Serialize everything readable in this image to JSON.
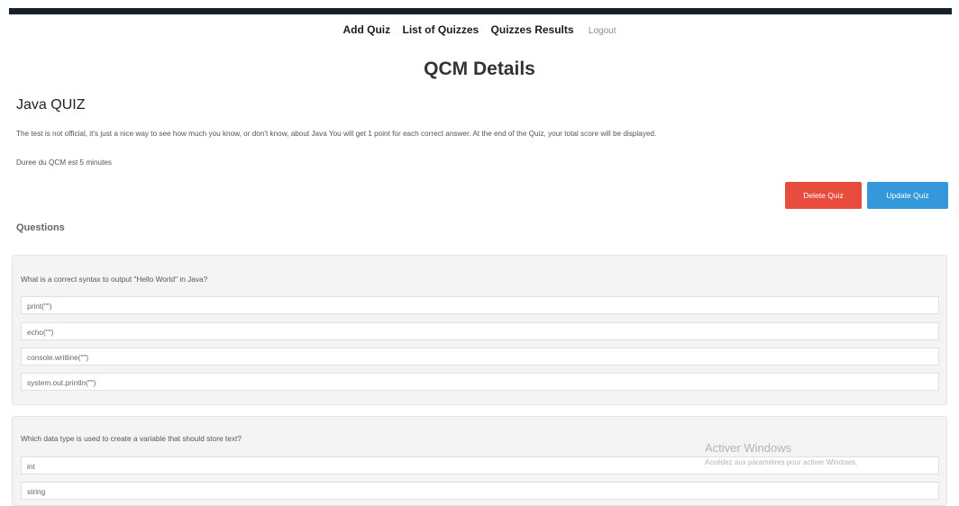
{
  "nav": {
    "add_quiz": "Add Quiz",
    "list_quizzes": "List of Quizzes",
    "quizzes_results": "Quizzes Results",
    "logout": "Logout"
  },
  "page_title": "QCM Details",
  "quiz": {
    "name": "Java QUIZ",
    "description": "The test is not official, it's just a nice way to see how much you know, or don't know, about Java You will get 1 point for each correct answer. At the end of the Quiz, your total score will be displayed.",
    "duration": "Duree du QCM est 5 minutes"
  },
  "buttons": {
    "delete": "Delete Quiz",
    "update": "Update Quiz"
  },
  "questions_heading": "Questions",
  "questions": [
    {
      "text": "What is a correct syntax to output \"Hello World\" in Java?",
      "options": [
        "print(\"\")",
        "echo(\"\")",
        "console.writline(\"\")",
        "system.out.println(\"\")"
      ]
    },
    {
      "text": "Which data type is used to create a variable that should store text?",
      "options": [
        "int",
        "string"
      ]
    }
  ],
  "watermark": {
    "line1": "Activer Windows",
    "line2": "Accédez aux paramètres pour activer Windows."
  }
}
